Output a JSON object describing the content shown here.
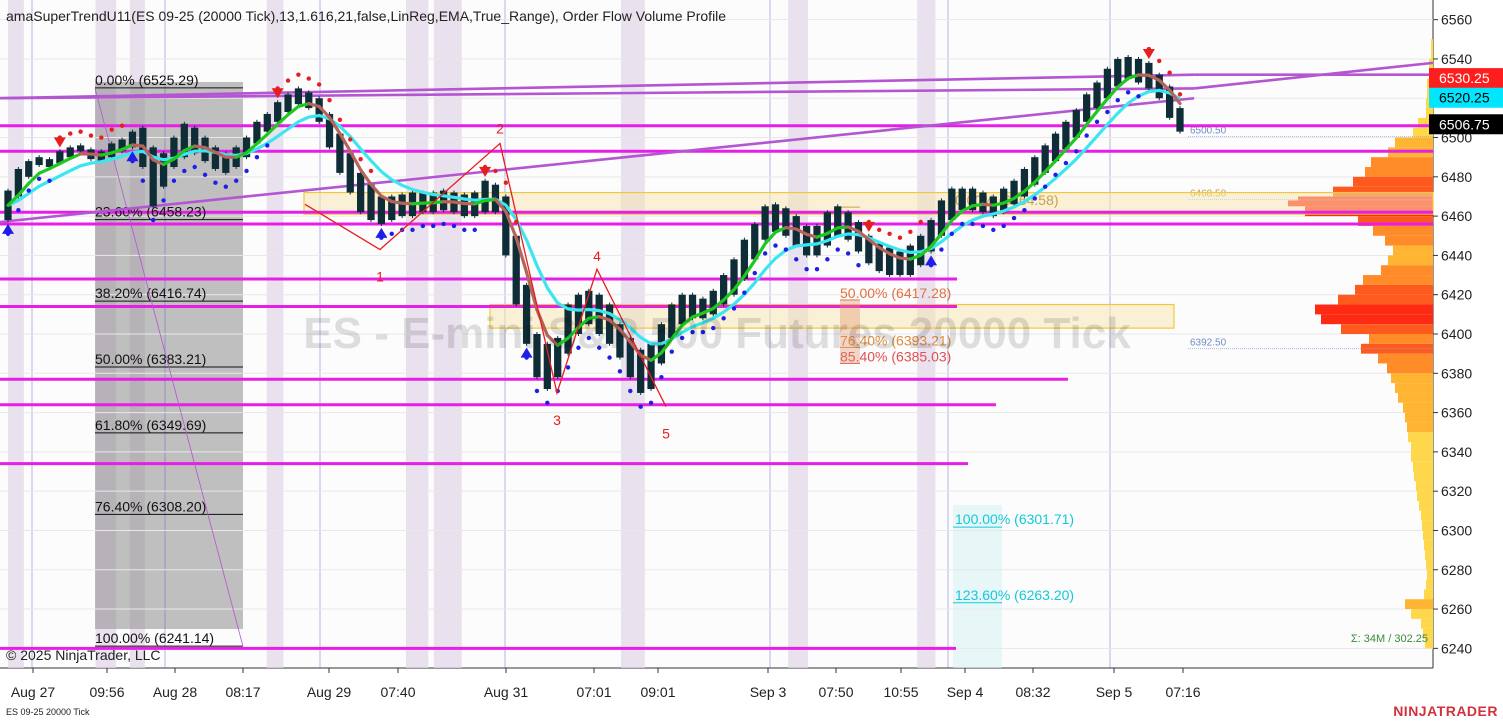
{
  "window": {
    "indicator_title": "amaSuperTrendU11(ES 09-25 (20000 Tick),13,1.616,21,false,LinReg,EMA,True_Range), Order Flow Volume Profile",
    "watermark": "ES - E-mini S&P 500 Futures 20000 Tick",
    "copyright": "© 2025 NinjaTrader, LLC",
    "instrument_label": "ES 09-25 20000 Tick",
    "brand": "NINJATRADER",
    "volume_summary": "Σ: 34M / 302.25"
  },
  "colors": {
    "background": "#fcfcfc",
    "grid": "#e8e8e8",
    "magenta_line": "#e61ee6",
    "trend_line": "#b455d2",
    "supertrend_up": "#1e1ee6",
    "supertrend_down": "#e61e1e",
    "cyan_ma": "#3ce6f0",
    "green_ma": "#1ec81e",
    "brown_ma": "#b4645a",
    "session_shade": "#e3d8ea",
    "candle": "#0f2d37",
    "price_red": "#ff1e1e",
    "price_cyan": "#00e6ff",
    "price_black": "#000000",
    "zone_fill": "#f5e6b4",
    "zone_border": "#f0c83c"
  },
  "chart_data": {
    "type": "candlestick",
    "instrument": "ES 09-25",
    "bar_type": "20000 Tick",
    "ylim": [
      6230,
      6570
    ],
    "y_ticks": [
      6240,
      6260,
      6280,
      6300,
      6320,
      6340,
      6360,
      6380,
      6400,
      6420,
      6440,
      6460,
      6480,
      6500,
      6520,
      6540,
      6560
    ],
    "x_ticks": [
      "Aug 27",
      "09:56",
      "Aug 28",
      "08:17",
      "Aug 29",
      "07:40",
      "Aug 31",
      "07:01",
      "09:01",
      "Sep 3",
      "07:50",
      "10:55",
      "Sep 4",
      "08:32",
      "Sep 5",
      "07:16"
    ],
    "price_labels": [
      {
        "text": "6530.25",
        "value": 6530.25,
        "kind": "red"
      },
      {
        "text": "6520.25",
        "value": 6520.25,
        "kind": "cyan"
      },
      {
        "text": "6506.75",
        "value": 6506.75,
        "kind": "black"
      }
    ],
    "fib_left": [
      {
        "text": "0.00% (6525.29)",
        "value": 6525.29
      },
      {
        "text": "23.60% (6458.23)",
        "value": 6458.23
      },
      {
        "text": "38.20% (6416.74)",
        "value": 6416.74
      },
      {
        "text": "50.00% (6383.21)",
        "value": 6383.21
      },
      {
        "text": "61.80% (6349.69)",
        "value": 6349.69
      },
      {
        "text": "76.40% (6308.20)",
        "value": 6308.2
      },
      {
        "text": "100.00% (6241.14)",
        "value": 6241.14
      }
    ],
    "fib_mid": [
      {
        "text": "0.00% (6464.58)",
        "value": 6464.58
      },
      {
        "text": "50.00% (6417.28)",
        "value": 6417.28
      },
      {
        "text": "76.40% (6393.21)",
        "value": 6393.21
      },
      {
        "text": "85.40% (6385.03)",
        "value": 6385.03
      }
    ],
    "fib_ext": [
      {
        "text": "100.00% (6301.71)",
        "value": 6301.71
      },
      {
        "text": "123.60% (6263.20)",
        "value": 6263.2
      }
    ],
    "horizontal_levels": [
      6506,
      6493,
      6462,
      6456,
      6428,
      6414,
      6377,
      6364,
      6334,
      6240
    ],
    "trend_lines": [
      {
        "t1": 0,
        "v1": 6457,
        "t2": 150,
        "v2": 6520
      },
      {
        "t1": 0,
        "v1": 6520,
        "t2": 150,
        "v2": 6532
      },
      {
        "t1": 150,
        "v1": 6532,
        "t2": 180,
        "v2": 6532
      },
      {
        "t1": 0,
        "v1": 6520,
        "t2": 150,
        "v2": 6525
      },
      {
        "t1": 150,
        "v1": 6525,
        "t2": 180,
        "v2": 6538
      }
    ],
    "zones": [
      {
        "from": 6461,
        "to": 6472
      },
      {
        "from": 6403,
        "to": 6415
      }
    ],
    "profile_labels": [
      {
        "text": "6500.50",
        "value": 6500.5
      },
      {
        "text": "6468.50",
        "value": 6468.5
      },
      {
        "text": "6392.50",
        "value": 6392.5
      }
    ],
    "waves": [
      {
        "text": "1",
        "value": 6443
      },
      {
        "text": "2",
        "value": 6498
      },
      {
        "text": "3",
        "value": 6370
      },
      {
        "text": "4",
        "value": 6433
      },
      {
        "text": "5",
        "value": 6363
      }
    ],
    "series": [
      {
        "name": "price",
        "values": [
          [
            6458,
            6473
          ],
          [
            6470,
            6484
          ],
          [
            6480,
            6488
          ],
          [
            6486,
            6490
          ],
          [
            6485,
            6489
          ],
          [
            6487,
            6493
          ],
          [
            6490,
            6495
          ],
          [
            6493,
            6496
          ],
          [
            6489,
            6494
          ],
          [
            6488,
            6493
          ],
          [
            6490,
            6497
          ],
          [
            6493,
            6499
          ],
          [
            6495,
            6503
          ],
          [
            6485,
            6505
          ],
          [
            6465,
            6495
          ],
          [
            6475,
            6492
          ],
          [
            6485,
            6500
          ],
          [
            6490,
            6507
          ],
          [
            6492,
            6505
          ],
          [
            6488,
            6500
          ],
          [
            6484,
            6495
          ],
          [
            6482,
            6492
          ],
          [
            6485,
            6495
          ],
          [
            6490,
            6500
          ],
          [
            6497,
            6508
          ],
          [
            6503,
            6512
          ],
          [
            6508,
            6518
          ],
          [
            6513,
            6522
          ],
          [
            6517,
            6525
          ],
          [
            6515,
            6523
          ],
          [
            6508,
            6520
          ],
          [
            6495,
            6512
          ],
          [
            6482,
            6502
          ],
          [
            6472,
            6492
          ],
          [
            6462,
            6482
          ],
          [
            6458,
            6476
          ],
          [
            6456,
            6470
          ],
          [
            6458,
            6470
          ],
          [
            6460,
            6471
          ],
          [
            6460,
            6472
          ],
          [
            6462,
            6472
          ],
          [
            6462,
            6472
          ],
          [
            6463,
            6473
          ],
          [
            6462,
            6472
          ],
          [
            6460,
            6471
          ],
          [
            6460,
            6472
          ],
          [
            6462,
            6478
          ],
          [
            6462,
            6476
          ],
          [
            6440,
            6470
          ],
          [
            6415,
            6450
          ],
          [
            6395,
            6425
          ],
          [
            6378,
            6400
          ],
          [
            6372,
            6395
          ],
          [
            6378,
            6398
          ],
          [
            6390,
            6415
          ],
          [
            6400,
            6420
          ],
          [
            6405,
            6422
          ],
          [
            6400,
            6420
          ],
          [
            6395,
            6415
          ],
          [
            6388,
            6405
          ],
          [
            6378,
            6398
          ],
          [
            6370,
            6392
          ],
          [
            6372,
            6395
          ],
          [
            6385,
            6405
          ],
          [
            6398,
            6415
          ],
          [
            6405,
            6420
          ],
          [
            6408,
            6420
          ],
          [
            6408,
            6418
          ],
          [
            6410,
            6422
          ],
          [
            6415,
            6430
          ],
          [
            6420,
            6438
          ],
          [
            6428,
            6448
          ],
          [
            6438,
            6456
          ],
          [
            6448,
            6465
          ],
          [
            6452,
            6466
          ],
          [
            6450,
            6464
          ],
          [
            6445,
            6460
          ],
          [
            6440,
            6455
          ],
          [
            6440,
            6455
          ],
          [
            6445,
            6462
          ],
          [
            6450,
            6465
          ],
          [
            6448,
            6462
          ],
          [
            6442,
            6457
          ],
          [
            6436,
            6450
          ],
          [
            6432,
            6446
          ],
          [
            6430,
            6444
          ],
          [
            6430,
            6442
          ],
          [
            6430,
            6445
          ],
          [
            6435,
            6450
          ],
          [
            6442,
            6458
          ],
          [
            6450,
            6468
          ],
          [
            6458,
            6474
          ],
          [
            6463,
            6474
          ],
          [
            6463,
            6474
          ],
          [
            6462,
            6472
          ],
          [
            6460,
            6470
          ],
          [
            6462,
            6474
          ],
          [
            6466,
            6478
          ],
          [
            6470,
            6484
          ],
          [
            6476,
            6490
          ],
          [
            6482,
            6496
          ],
          [
            6488,
            6502
          ],
          [
            6494,
            6508
          ],
          [
            6500,
            6514
          ],
          [
            6508,
            6522
          ],
          [
            6515,
            6528
          ],
          [
            6520,
            6535
          ],
          [
            6526,
            6540
          ],
          [
            6530,
            6541
          ],
          [
            6528,
            6540
          ],
          [
            6525,
            6538
          ],
          [
            6520,
            6532
          ],
          [
            6510,
            6526
          ],
          [
            6503,
            6515
          ]
        ]
      }
    ],
    "supertrend": {
      "down_segments": [
        [
          5,
          11
        ],
        [
          26,
          35
        ],
        [
          46,
          49
        ],
        [
          83,
          88
        ],
        [
          110,
          113
        ]
      ],
      "up_segments": [
        [
          0,
          4
        ],
        [
          12,
          25
        ],
        [
          36,
          45
        ],
        [
          50,
          82
        ],
        [
          89,
          109
        ]
      ]
    },
    "volume_profile": [
      [
        6560,
        0
      ],
      [
        6550,
        2
      ],
      [
        6540,
        4
      ],
      [
        6530,
        6
      ],
      [
        6520,
        7
      ],
      [
        6510,
        15
      ],
      [
        6505,
        20
      ],
      [
        6500,
        38
      ],
      [
        6495,
        45
      ],
      [
        6490,
        62
      ],
      [
        6485,
        68
      ],
      [
        6480,
        80
      ],
      [
        6475,
        100
      ],
      [
        6470,
        135
      ],
      [
        6468,
        145
      ],
      [
        6465,
        128
      ],
      [
        6460,
        75
      ],
      [
        6455,
        60
      ],
      [
        6450,
        48
      ],
      [
        6445,
        40
      ],
      [
        6440,
        45
      ],
      [
        6435,
        52
      ],
      [
        6430,
        70
      ],
      [
        6425,
        78
      ],
      [
        6420,
        95
      ],
      [
        6415,
        118
      ],
      [
        6410,
        112
      ],
      [
        6405,
        92
      ],
      [
        6400,
        64
      ],
      [
        6395,
        72
      ],
      [
        6390,
        55
      ],
      [
        6385,
        46
      ],
      [
        6380,
        42
      ],
      [
        6375,
        38
      ],
      [
        6370,
        35
      ],
      [
        6365,
        30
      ],
      [
        6360,
        28
      ],
      [
        6355,
        26
      ],
      [
        6350,
        25
      ],
      [
        6345,
        22
      ],
      [
        6340,
        22
      ],
      [
        6335,
        20
      ],
      [
        6330,
        19
      ],
      [
        6325,
        17
      ],
      [
        6320,
        16
      ],
      [
        6315,
        14
      ],
      [
        6310,
        12
      ],
      [
        6305,
        11
      ],
      [
        6300,
        10
      ],
      [
        6295,
        9
      ],
      [
        6290,
        8
      ],
      [
        6285,
        7
      ],
      [
        6280,
        6
      ],
      [
        6275,
        7
      ],
      [
        6270,
        9
      ],
      [
        6265,
        28
      ],
      [
        6260,
        22
      ],
      [
        6255,
        12
      ],
      [
        6250,
        10
      ],
      [
        6245,
        8
      ],
      [
        6240,
        6
      ]
    ]
  }
}
